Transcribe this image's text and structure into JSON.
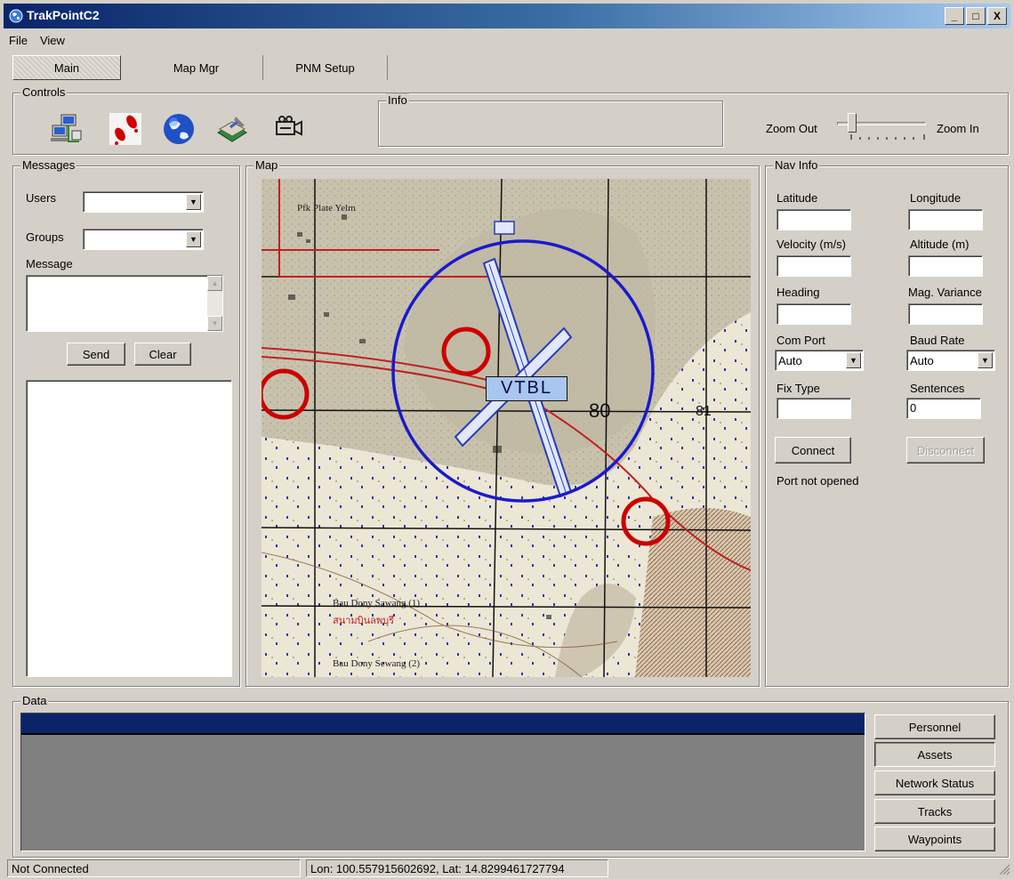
{
  "window": {
    "title": "TrakPointC2",
    "minimize": "_",
    "maximize": "□",
    "close": "X"
  },
  "menu": [
    "File",
    "View"
  ],
  "tabs": [
    "Main",
    "Map Mgr",
    "PNM Setup"
  ],
  "controls": {
    "legend": "Controls",
    "toolbar_icons": [
      "network-computers-icon",
      "footprints-icon",
      "globe-icon",
      "layers-tool-icon",
      "video-camera-icon"
    ],
    "info_legend": "Info",
    "zoom_out": "Zoom Out",
    "zoom_in": "Zoom In",
    "zoom_level": 0.1
  },
  "messages": {
    "legend": "Messages",
    "users_label": "Users",
    "users_value": "",
    "groups_label": "Groups",
    "groups_value": "",
    "message_label": "Message",
    "send": "Send",
    "clear": "Clear"
  },
  "map": {
    "legend": "Map",
    "marker_label": "VTBL",
    "grid_numbers": [
      "80",
      "81"
    ]
  },
  "nav": {
    "legend": "Nav Info",
    "latitude": "Latitude",
    "longitude": "Longitude",
    "velocity": "Velocity (m/s)",
    "altitude": "Altitude (m)",
    "heading": "Heading",
    "mag_variance": "Mag. Variance",
    "com_port": "Com Port",
    "com_port_value": "Auto",
    "baud_rate": "Baud Rate",
    "baud_rate_value": "Auto",
    "fix_type": "Fix Type",
    "sentences": "Sentences",
    "sentences_value": "0",
    "connect": "Connect",
    "disconnect": "Disconnect",
    "port_status": "Port not opened"
  },
  "data": {
    "legend": "Data",
    "buttons": [
      "Personnel",
      "Assets",
      "Network Status",
      "Tracks",
      "Waypoints"
    ]
  },
  "status": {
    "connection": "Not Connected",
    "coords": "Lon: 100.557915602692, Lat: 14.8299461727794"
  },
  "colors": {
    "title_start": "#0a246a",
    "title_end": "#a6caf0",
    "grid_header": "#0a246a",
    "grid_body": "#808080",
    "marker_ring": "#1a1acc",
    "poi_ring": "#cc0000"
  }
}
